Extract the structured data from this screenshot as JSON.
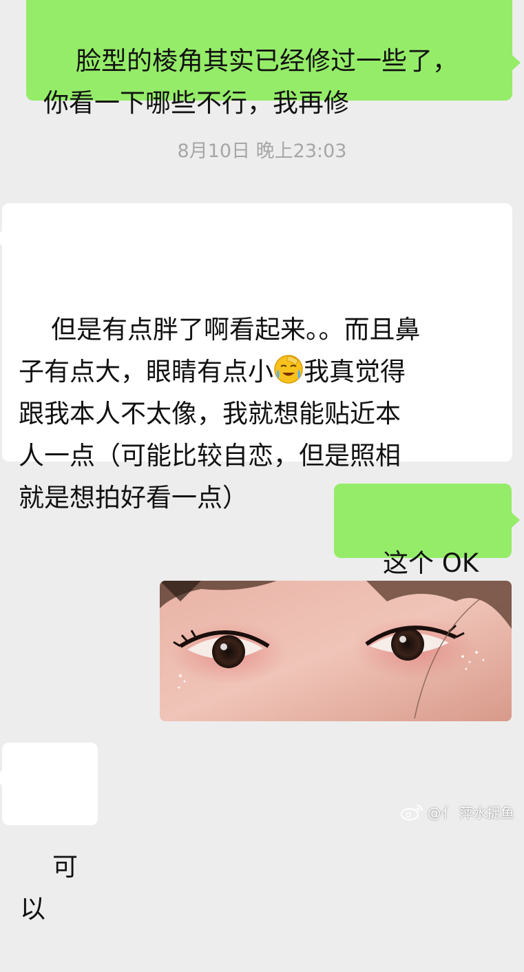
{
  "chat": {
    "messages": [
      {
        "side": "sent",
        "text": "脸型的棱角其实已经修过一些了，\n你看一下哪些不行，我再修"
      },
      {
        "side": "timestamp",
        "text": "8月10日 晚上23:03"
      },
      {
        "side": "received",
        "text_before_emoji": "但是有点胖了啊看起来。。而且鼻\n子有点大，眼睛有点小",
        "emoji": "face-palm-crying-emoji",
        "text_after_emoji": "我真觉得\n跟我本人不太像，我就想能贴近本\n人一点（可能比较自恋，但是照相\n就是想拍好看一点）"
      },
      {
        "side": "sent",
        "text": "这个 OK 吗"
      },
      {
        "side": "sent",
        "image": "eyes-closeup-photo"
      },
      {
        "side": "received",
        "text": "可以"
      }
    ]
  },
  "watermark": {
    "icon": "weibo-icon",
    "text": "@亻 萍水捉鱼"
  },
  "colors": {
    "background": "#ededed",
    "sent_bubble": "#95ec69",
    "received_bubble": "#ffffff",
    "timestamp": "#a6a6a6"
  }
}
